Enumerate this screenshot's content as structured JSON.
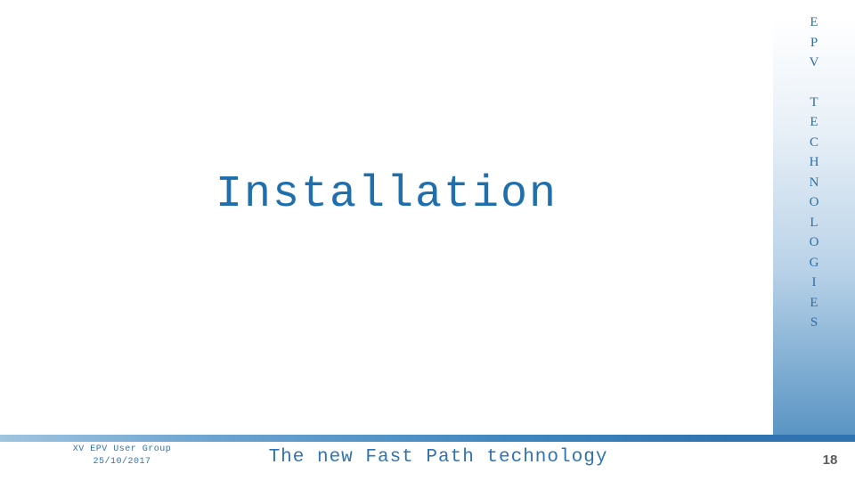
{
  "slide": {
    "title": "Installation",
    "page_number": "18",
    "vertical_banner": {
      "group1": [
        "E",
        "P",
        "V"
      ],
      "group2": [
        "T",
        "E",
        "C",
        "H",
        "N",
        "O",
        "L",
        "O",
        "G",
        "I",
        "E",
        "S"
      ],
      "color": "#2f6ea5"
    },
    "footer": {
      "left_line1": "XV EPV User Group",
      "left_line2": "25/10/2017",
      "center": "The new Fast Path technology"
    },
    "colors": {
      "accent": "#2f74b0",
      "title": "#1f6fad",
      "page_number": "#5a5a5a",
      "background": "#ffffff"
    }
  }
}
